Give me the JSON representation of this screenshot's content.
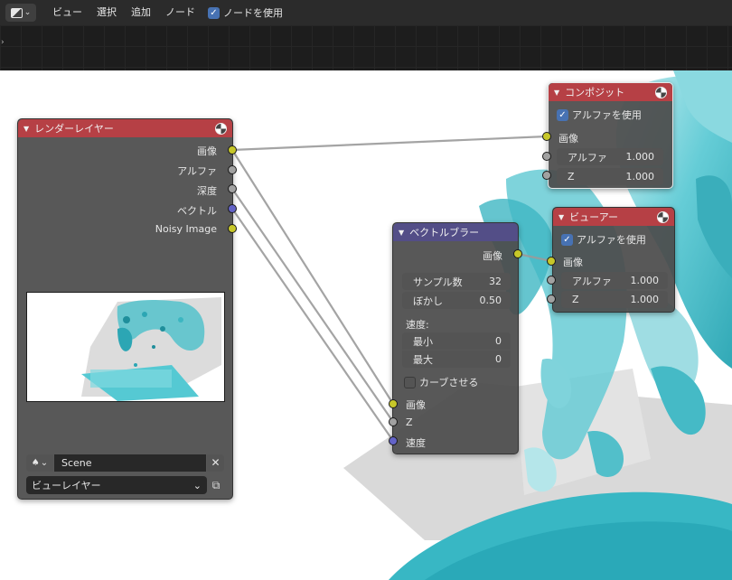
{
  "header": {
    "menus": [
      "ビュー",
      "選択",
      "追加",
      "ノード"
    ],
    "use_nodes_label": "ノードを使用",
    "use_nodes_checked": true
  },
  "render_layers_node": {
    "title": "レンダーレイヤー",
    "outputs": [
      {
        "label": "画像",
        "socket": "yellow"
      },
      {
        "label": "アルファ",
        "socket": "gray"
      },
      {
        "label": "深度",
        "socket": "gray"
      },
      {
        "label": "ベクトル",
        "socket": "blue"
      },
      {
        "label": "Noisy Image",
        "socket": "yellow"
      }
    ],
    "scene_value": "Scene",
    "view_layer_value": "ビューレイヤー"
  },
  "composite_node": {
    "title": "コンポジット",
    "use_alpha_label": "アルファを使用",
    "use_alpha_checked": true,
    "inputs": [
      {
        "label": "画像"
      },
      {
        "label": "アルファ",
        "value": "1.000"
      },
      {
        "label": "Z",
        "value": "1.000"
      }
    ]
  },
  "viewer_node": {
    "title": "ビューアー",
    "use_alpha_label": "アルファを使用",
    "use_alpha_checked": true,
    "inputs": [
      {
        "label": "画像"
      },
      {
        "label": "アルファ",
        "value": "1.000"
      },
      {
        "label": "Z",
        "value": "1.000"
      }
    ]
  },
  "vector_blur_node": {
    "title": "ベクトルブラー",
    "output_label": "画像",
    "samples_label": "サンプル数",
    "samples_value": "32",
    "blur_label": "ぼかし",
    "blur_value": "0.50",
    "speed_label": "速度:",
    "min_label": "最小",
    "min_value": "0",
    "max_label": "最大",
    "max_value": "0",
    "curved_label": "カーブさせる",
    "curved_checked": false,
    "inputs": [
      "画像",
      "Z",
      "速度"
    ]
  },
  "colors": {
    "node_header_red": "#b64045",
    "node_header_purple": "#534e87",
    "socket_yellow": "#c7c729",
    "socket_gray": "#a1a1a1",
    "socket_blue": "#6363c7",
    "checkbox_blue": "#4772b3",
    "water": "#2fb6c4"
  }
}
